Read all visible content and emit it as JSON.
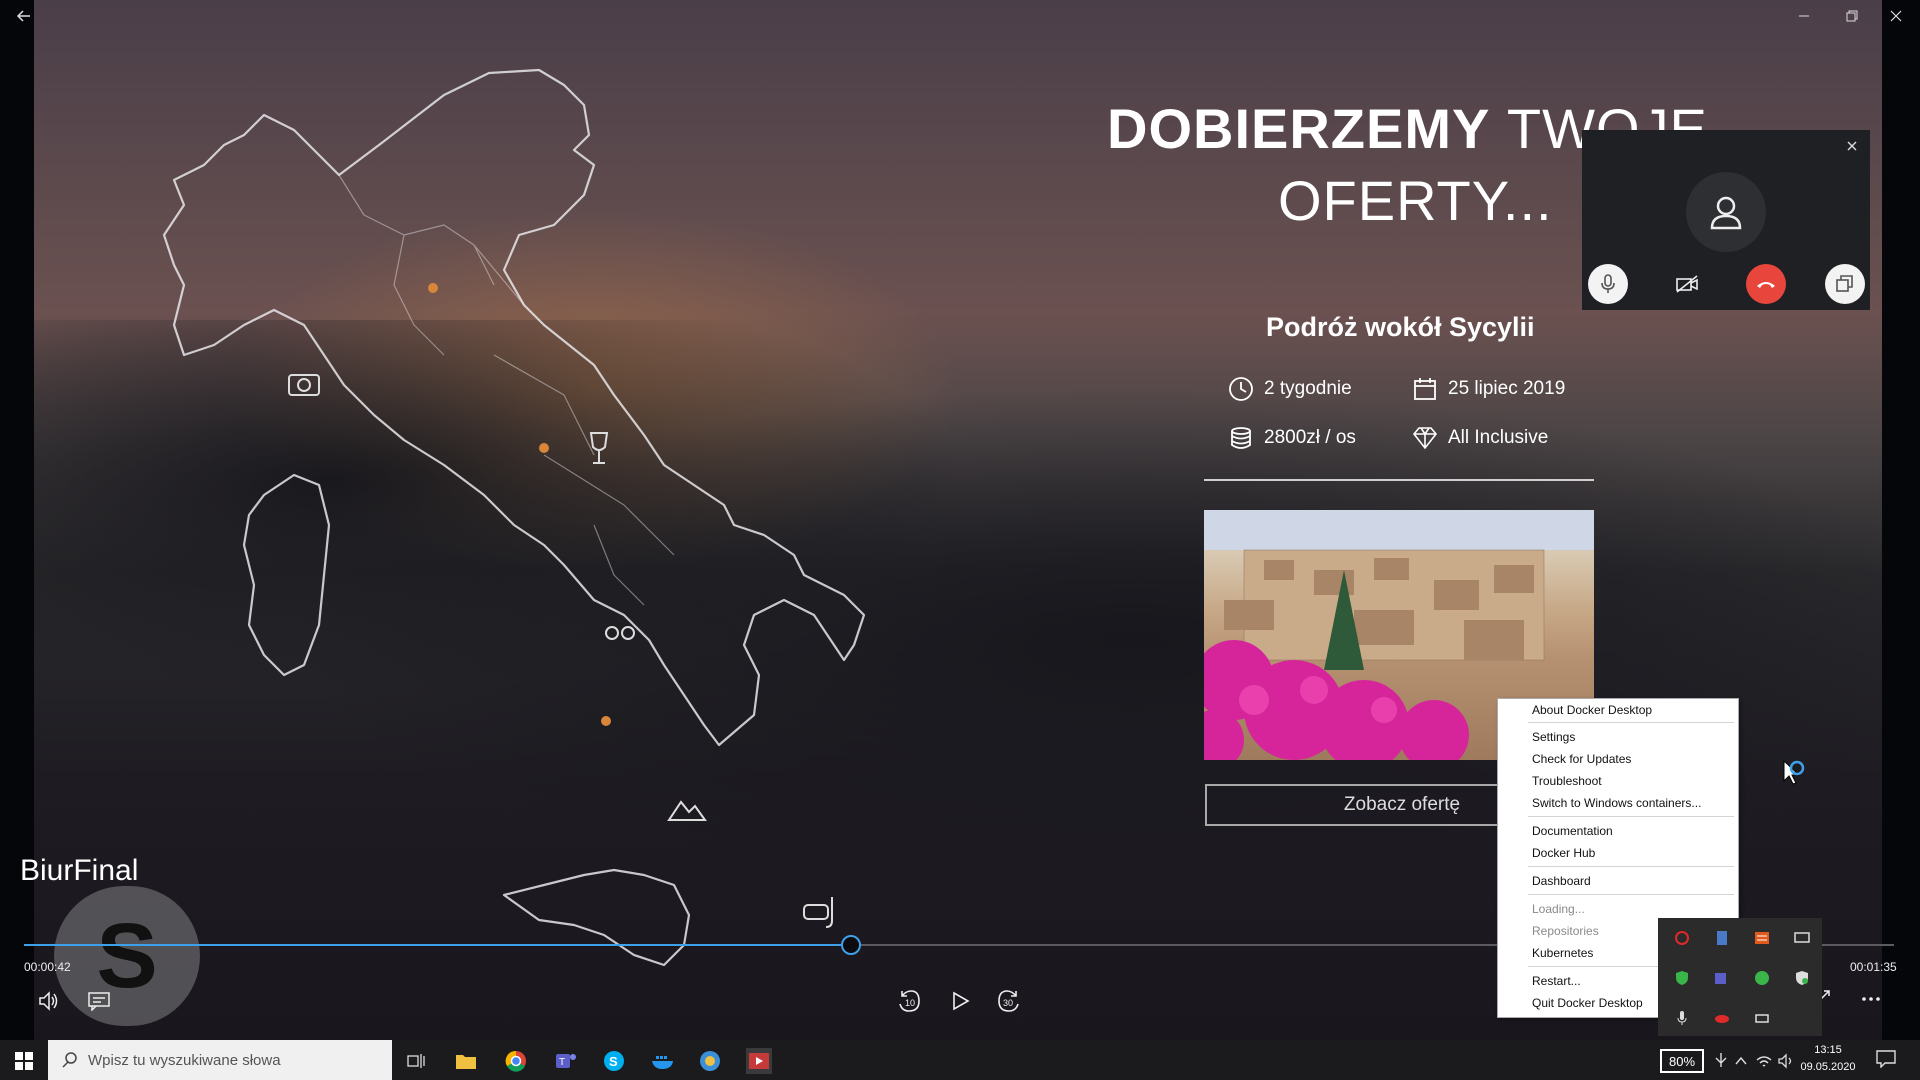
{
  "video": {
    "headline_bold": "DOBIERZEMY",
    "headline_light_1": "TWOJE",
    "headline_light_2": "OFERTY...",
    "trip_title": "Podróż wokół Sycylii",
    "info": {
      "duration": "2 tygodnie",
      "date": "25 lipiec 2019",
      "price": "2800zł / os",
      "board": "All Inclusive"
    },
    "cta_label": "Zobacz ofertę",
    "caption_name": "BiurFinal"
  },
  "call_overlay": {
    "close_icon": "close-icon",
    "buttons": [
      "microphone-icon",
      "video-off-icon",
      "hang-up-icon",
      "restore-window-icon"
    ],
    "hangup_color": "#e8463c"
  },
  "player": {
    "elapsed": "00:00:42",
    "total": "00:01:35",
    "progress": 0.442,
    "skip_back_label": "10",
    "skip_forward_label": "30",
    "accent": "#3ea0e8"
  },
  "docker_menu": {
    "items": [
      {
        "label": "About Docker Desktop",
        "disabled": false
      },
      {
        "label": "Settings",
        "disabled": false
      },
      {
        "label": "Check for Updates",
        "disabled": false
      },
      {
        "label": "Troubleshoot",
        "disabled": false
      },
      {
        "label": "Switch to Windows containers...",
        "disabled": false
      },
      {
        "label": "Documentation",
        "disabled": false
      },
      {
        "label": "Docker Hub",
        "disabled": false
      },
      {
        "label": "Dashboard",
        "disabled": false
      },
      {
        "label": "Loading...",
        "disabled": true
      },
      {
        "label": "Repositories",
        "disabled": true
      },
      {
        "label": "Kubernetes",
        "disabled": false
      },
      {
        "label": "Restart...",
        "disabled": false
      },
      {
        "label": "Quit Docker Desktop",
        "disabled": false
      }
    ]
  },
  "taskbar": {
    "search_placeholder": "Wpisz tu wyszukiwane słowa",
    "battery": "80%",
    "time": "13:15",
    "date": "09.05.2020",
    "apps": [
      "task-view-icon",
      "file-explorer-icon",
      "chrome-icon",
      "teams-icon",
      "skype-icon",
      "docker-icon",
      "app-icon",
      "video-app-icon"
    ]
  }
}
